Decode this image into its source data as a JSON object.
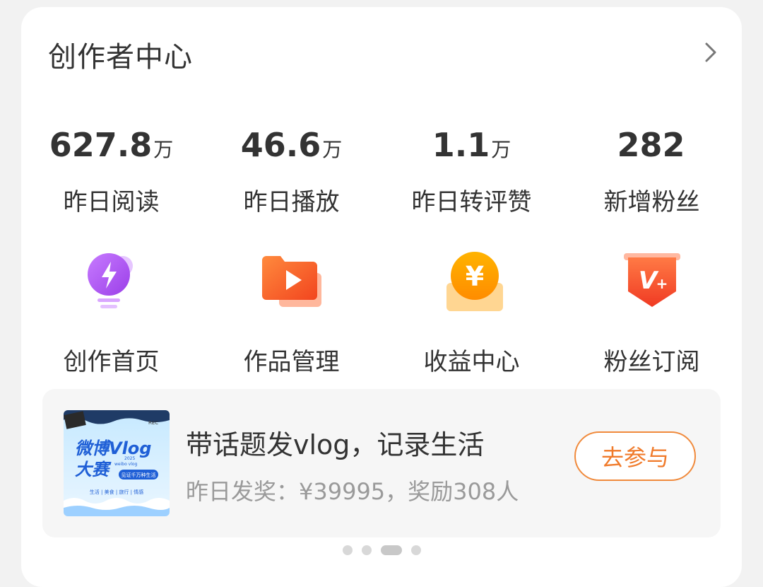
{
  "header": {
    "title": "创作者中心",
    "chevron_icon": "chevron-right-icon"
  },
  "stats": [
    {
      "value": "627.8",
      "unit": "万",
      "label": "昨日阅读"
    },
    {
      "value": "46.6",
      "unit": "万",
      "label": "昨日播放"
    },
    {
      "value": "1.1",
      "unit": "万",
      "label": "昨日转评赞"
    },
    {
      "value": "282",
      "unit": "",
      "label": "新增粉丝"
    }
  ],
  "tools": [
    {
      "label": "创作首页",
      "icon": "lightning-bulb-icon",
      "color": "#b15cf0"
    },
    {
      "label": "作品管理",
      "icon": "video-folder-icon",
      "color": "#ff6a3d"
    },
    {
      "label": "收益中心",
      "icon": "yuan-coin-icon",
      "color": "#ffb300"
    },
    {
      "label": "粉丝订阅",
      "icon": "v-plus-badge-icon",
      "color": "#f2572d"
    }
  ],
  "promo": {
    "thumb_text": {
      "line1": "微博Vlog",
      "line2": "大赛",
      "year": "2025",
      "brand": "weibo vlog",
      "slogan": "见证千万种生活",
      "tags": "生活 | 美食 | 旅行 | 情感",
      "rec": "REC"
    },
    "title": "带话题发vlog，记录生活",
    "subtitle": "昨日发奖：¥39995，奖励308人",
    "button": "去参与"
  },
  "pager": {
    "count": 4,
    "active": 2
  },
  "colors": {
    "accent": "#f07a2a",
    "background": "#f2f2f2",
    "card": "#ffffff"
  }
}
